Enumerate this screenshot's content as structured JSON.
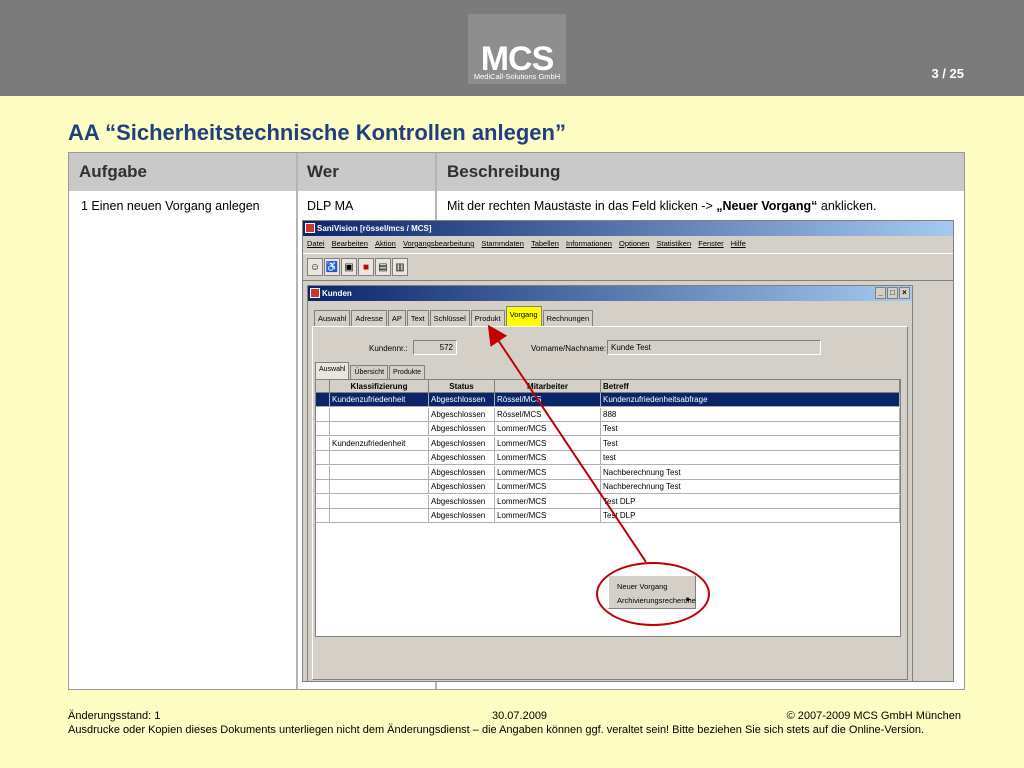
{
  "header": {
    "logo_main": "MCS",
    "logo_sub": "MediCall-Solutions GmbH",
    "page_number": "3 / 25"
  },
  "title": "AA “Sicherheitstechnische Kontrollen anlegen”",
  "table": {
    "headers": [
      "Aufgabe",
      "Wer",
      "Beschreibung"
    ],
    "row": {
      "aufgabe": "1 Einen neuen Vorgang anlegen",
      "wer": "DLP MA",
      "beschreibung_pre": "Mit der rechten Maustaste in das Feld klicken -> ",
      "beschreibung_bold": "„Neuer Vorgang“",
      "beschreibung_post": " anklicken."
    }
  },
  "app": {
    "title": "SaniVision [rössel/mcs / MCS]",
    "menu": [
      "Datei",
      "Bearbeiten",
      "Aktion",
      "Vorgangsbearbeitung",
      "Stammdaten",
      "Tabellen",
      "Informationen",
      "Optionen",
      "Statistiken",
      "Fenster",
      "Hilfe"
    ],
    "window": {
      "title": "Kunden",
      "tabs": [
        "Auswahl",
        "Adresse",
        "AP",
        "Text",
        "Schlüssel",
        "Produkt",
        "Vorgang",
        "Rechnungen"
      ],
      "kundennr_label": "Kundennr.:",
      "kundennr_value": "572",
      "name_label": "Vorname/Nachname:",
      "name_value": "Kunde Test",
      "subtabs": [
        "Auswahl",
        "Übersicht",
        "Produkte"
      ],
      "grid": {
        "columns": [
          "Klassifizierung",
          "Status",
          "Mitarbeiter",
          "Betreff"
        ],
        "rows": [
          [
            "Kundenzufriedenheit",
            "Abgeschlossen",
            "Rössel/MCS",
            "Kundenzufriedenheitsabfrage"
          ],
          [
            "",
            "Abgeschlossen",
            "Rössel/MCS",
            "888"
          ],
          [
            "",
            "Abgeschlossen",
            "Lommer/MCS",
            "Test"
          ],
          [
            "Kundenzufriedenheit",
            "Abgeschlossen",
            "Lommer/MCS",
            "Test"
          ],
          [
            "",
            "Abgeschlossen",
            "Lommer/MCS",
            "test"
          ],
          [
            "",
            "Abgeschlossen",
            "Lommer/MCS",
            "Nachberechnung Test"
          ],
          [
            "",
            "Abgeschlossen",
            "Lommer/MCS",
            "Nachberechnung Test"
          ],
          [
            "",
            "Abgeschlossen",
            "Lommer/MCS",
            "Test DLP"
          ],
          [
            "",
            "Abgeschlossen",
            "Lommer/MCS",
            "Test DLP"
          ]
        ]
      }
    },
    "context_menu": [
      "Neuer Vorgang",
      "Archivierungsrecherche"
    ]
  },
  "footer": {
    "stand": "Änderungsstand: 1",
    "date": "30.07.2009",
    "copyright": "© 2007-2009 MCS GmbH München",
    "disclaimer": "Ausdrucke oder Kopien dieses Dokuments unterliegen nicht dem Änderungsdienst – die Angaben können ggf. veraltet sein! Bitte beziehen Sie sich stets auf die Online-Version."
  },
  "colors": {
    "background": "#fdfdc4",
    "header": "#7b7b7b",
    "title": "#1f3f7f",
    "highlight_tab": "#ffff00",
    "annotation": "#c00000",
    "selection": "#0a246a"
  }
}
